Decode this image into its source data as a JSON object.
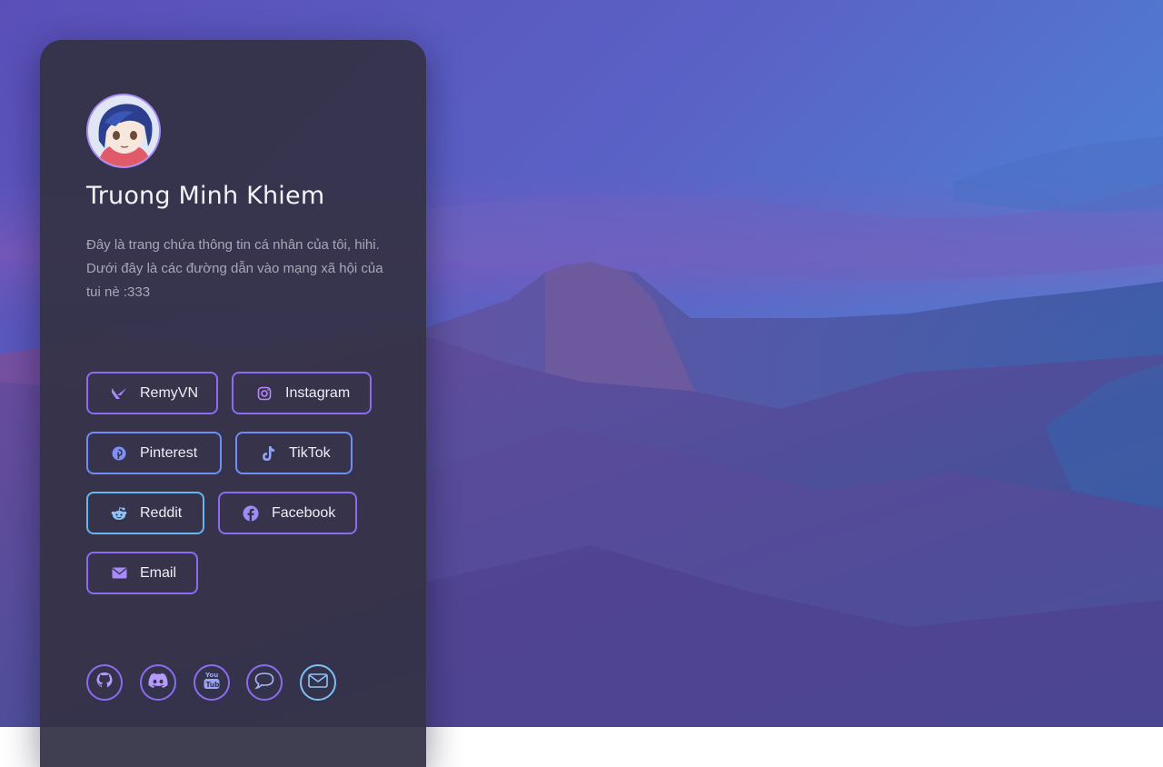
{
  "profile": {
    "name": "Truong Minh Khiem",
    "bio": "Đây là trang chứa thông tin cá nhân của tôi, hihi. Dưới đây là các đường dẫn vào mạng xã hội của tui nè :333"
  },
  "links": [
    {
      "label": "RemyVN",
      "icon": "valorant-icon"
    },
    {
      "label": "Instagram",
      "icon": "instagram-icon"
    },
    {
      "label": "Pinterest",
      "icon": "pinterest-icon"
    },
    {
      "label": "TikTok",
      "icon": "tiktok-icon"
    },
    {
      "label": "Reddit",
      "icon": "reddit-icon"
    },
    {
      "label": "Facebook",
      "icon": "facebook-icon"
    },
    {
      "label": "Email",
      "icon": "email-icon"
    }
  ],
  "footer_icons": [
    "github-icon",
    "discord-icon",
    "youtube-icon",
    "chat-icon",
    "mail-icon"
  ],
  "colors": {
    "accent_purple": "#8b6cf0",
    "accent_blue": "#6f8df5",
    "accent_cyan": "#66b6ef",
    "card_bg": "#343246"
  }
}
